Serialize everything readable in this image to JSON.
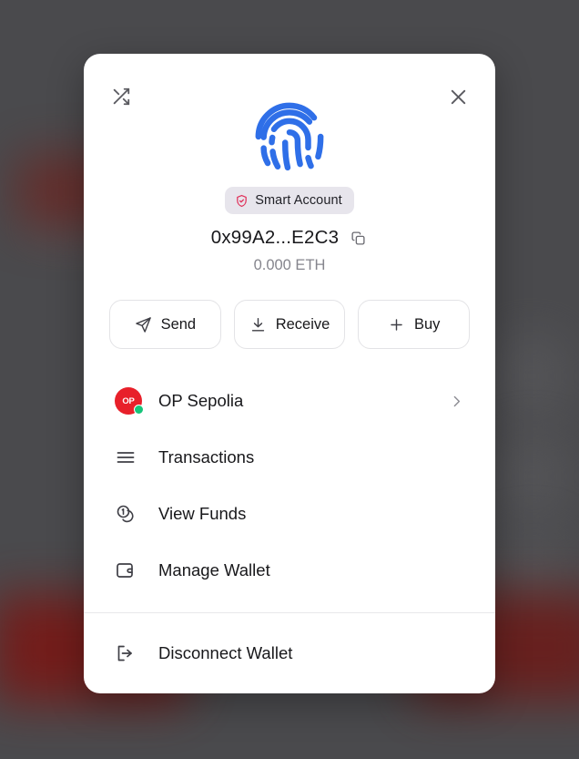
{
  "backdrop": {
    "overlay_color": "#4a4a4d"
  },
  "modal": {
    "header": {
      "shuffle_icon": "shuffle-icon",
      "close_icon": "close-icon"
    },
    "identity": {
      "avatar_icon": "fingerprint-icon",
      "avatar_color": "#2f6fe8",
      "badge": {
        "icon": "shield-check-icon",
        "icon_color": "#e0315a",
        "label": "Smart Account",
        "background": "#e7e5ec"
      },
      "address": "0x99A2...E2C3",
      "copy_icon": "copy-icon",
      "balance": "0.000 ETH"
    },
    "actions": [
      {
        "label": "Send",
        "icon": "send-plane-icon"
      },
      {
        "label": "Receive",
        "icon": "download-arrow-icon"
      },
      {
        "label": "Buy",
        "icon": "plus-icon"
      }
    ],
    "menu": [
      {
        "label": "OP Sepolia",
        "icon": "network-avatar-icon",
        "avatar_text": "OP",
        "avatar_color": "#e8202a",
        "status_dot_color": "#16c47a",
        "chevron": "chevron-right-icon"
      },
      {
        "label": "Transactions",
        "icon": "list-lines-icon"
      },
      {
        "label": "View Funds",
        "icon": "coins-icon"
      },
      {
        "label": "Manage Wallet",
        "icon": "wallet-icon"
      }
    ],
    "footer": [
      {
        "label": "Disconnect Wallet",
        "icon": "logout-icon"
      }
    ]
  }
}
